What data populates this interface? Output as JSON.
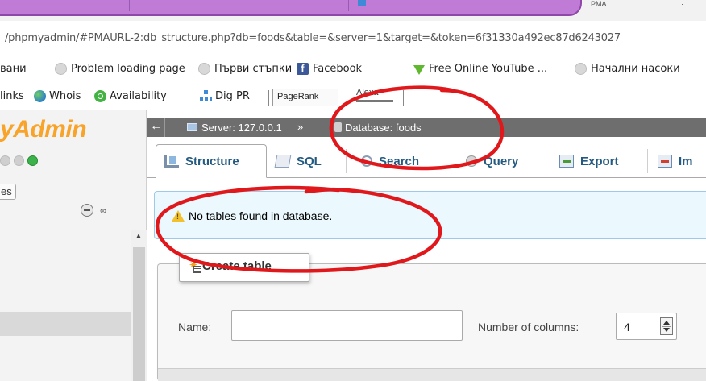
{
  "browser": {
    "tab_title": "PMA",
    "tab_close": "·",
    "url": "/phpmyadmin/#PMAURL-2:db_structure.php?db=foods&table=&server=1&target=&token=6f31330a492ec87d6243027"
  },
  "bookmarks": [
    {
      "label": "вани",
      "icon": "none"
    },
    {
      "label": "Problem loading page",
      "icon": "globe-grey-icon"
    },
    {
      "label": "Първи стъпки",
      "icon": "globe-grey-icon"
    },
    {
      "label": "Facebook",
      "icon": "facebook-icon"
    },
    {
      "label": "Free Online YouTube ...",
      "icon": "download-arrow-icon"
    },
    {
      "label": "Начални насоки",
      "icon": "globe-grey-icon"
    }
  ],
  "seo_toolbar": {
    "links": "links",
    "whois": "Whois",
    "availability": "Availability",
    "dig_pr": "Dig PR",
    "pagerank": "PageRank",
    "alexa": "Alexa"
  },
  "sidebar": {
    "logo": "Admin",
    "logo_prefix": "y",
    "db_tab": "es",
    "minus_icon": "collapse-icon",
    "link_symbol": "∞"
  },
  "breadcrumb": {
    "back": "←",
    "server": "Server: 127.0.0.1",
    "arrow": "»",
    "database": "Database: foods"
  },
  "tabs": [
    {
      "label": "Structure",
      "icon": "structure-icon",
      "active": true
    },
    {
      "label": "SQL",
      "icon": "sql-icon",
      "active": false
    },
    {
      "label": "Search",
      "icon": "search-icon",
      "active": false
    },
    {
      "label": "Query",
      "icon": "query-icon",
      "active": false
    },
    {
      "label": "Export",
      "icon": "export-icon",
      "active": false
    },
    {
      "label": "Im",
      "icon": "import-icon",
      "active": false
    }
  ],
  "notice": {
    "text": "No tables found in database."
  },
  "create_table": {
    "legend": "Create table",
    "name_label": "Name:",
    "name_value": "",
    "columns_label": "Number of columns:",
    "columns_value": "4"
  },
  "colors": {
    "accent_link": "#235a81",
    "annotation_red": "#e0181b",
    "logo_orange": "#f8a32a",
    "notice_bg": "#ebf8fd"
  }
}
